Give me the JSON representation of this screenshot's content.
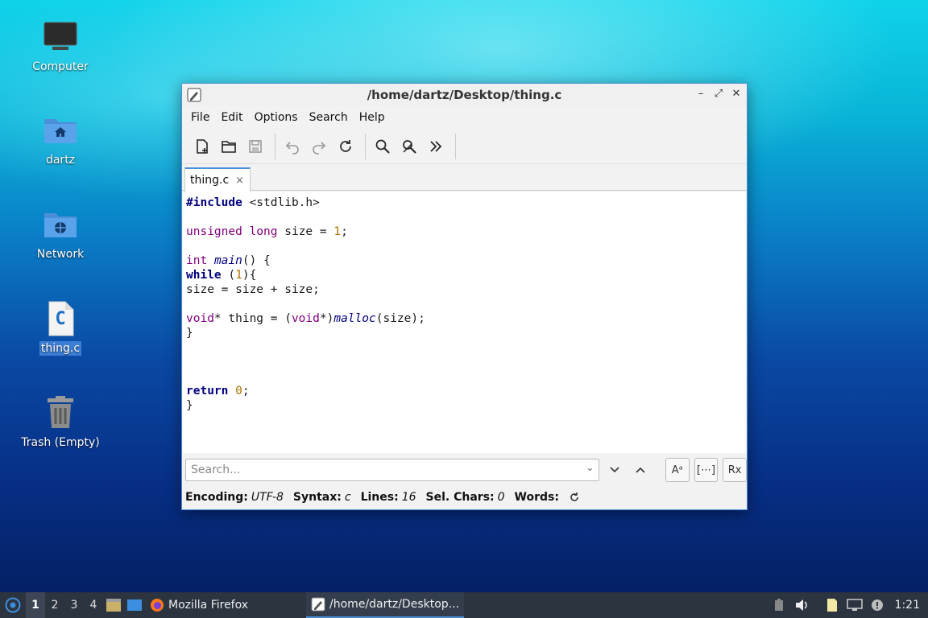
{
  "desktop": {
    "icons": [
      {
        "label": "Computer"
      },
      {
        "label": "dartz"
      },
      {
        "label": "Network"
      },
      {
        "label": "thing.c"
      },
      {
        "label": "Trash (Empty)"
      }
    ],
    "file_glyph": "C"
  },
  "window": {
    "title": "/home/dartz/Desktop/thing.c",
    "menu": [
      "File",
      "Edit",
      "Options",
      "Search",
      "Help"
    ],
    "tab": {
      "label": "thing.c",
      "close": "×"
    },
    "code": {
      "include_kw": "#include",
      "include_file": " <stdlib.h>",
      "l3_type1": "unsigned",
      "l3_type2": "long",
      "l3_rest": " size = ",
      "l3_num": "1",
      "l3_end": ";",
      "l5_type": "int",
      "l5_fn": "main",
      "l5_rest": "() {",
      "l6_kw": "while",
      "l6_a": " (",
      "l6_num": "1",
      "l6_b": "){",
      "l7": "size = size + size;",
      "l9_type": "void",
      "l9_a": "* thing = (",
      "l9_type2": "void",
      "l9_b": "*)",
      "l9_fn": "malloc",
      "l9_c": "(size);",
      "l10": "}",
      "l14_kw": "return",
      "l14_sp": " ",
      "l14_num": "0",
      "l14_end": ";",
      "l15": "}"
    },
    "search": {
      "placeholder": "Search...",
      "btn_case": "Aᵃ",
      "btn_word": "[⋯]",
      "btn_regex": "Rx"
    },
    "status": {
      "encoding_k": "Encoding:",
      "encoding_v": "UTF-8",
      "syntax_k": "Syntax:",
      "syntax_v": "c",
      "lines_k": "Lines:",
      "lines_v": "16",
      "sel_k": "Sel. Chars:",
      "sel_v": "0",
      "words_k": "Words:"
    }
  },
  "taskbar": {
    "workspaces": [
      "1",
      "2",
      "3",
      "4"
    ],
    "tasks": [
      {
        "label": "Mozilla Firefox"
      },
      {
        "label": "/home/dartz/Desktop..."
      }
    ],
    "clock": "1:21"
  }
}
